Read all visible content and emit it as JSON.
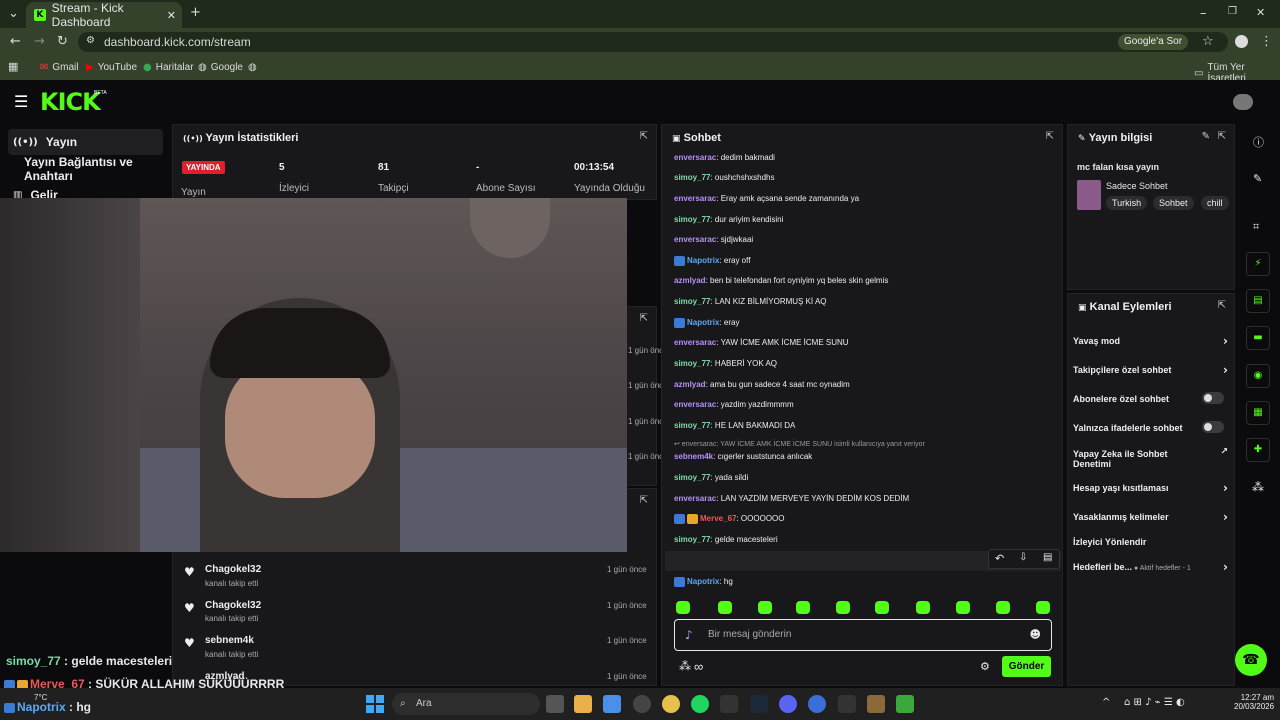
{
  "browser": {
    "tab_title": "Stream - Kick Dashboard",
    "url": "dashboard.kick.com/stream",
    "google_ask": "Google'a Sor",
    "bookmarks": [
      "Gmail",
      "YouTube",
      "Haritalar",
      "Google"
    ],
    "all_bookmarks": "Tüm Yer İşaretleri"
  },
  "kick": {
    "logo": "KICK",
    "beta": "BETA"
  },
  "sidebar": {
    "items": [
      {
        "label": "Yayın",
        "icon": "broadcast-icon"
      },
      {
        "label": "Yayın Bağlantısı ve Anahtarı"
      },
      {
        "label": "Gelir",
        "icon": "chart-icon"
      }
    ]
  },
  "stats": {
    "title": "Yayın İstatistikleri",
    "live_badge": "YAYINDA",
    "live_label": "Yayın",
    "viewers_value": "5",
    "viewers_label": "İzleyici",
    "followers_value": "81",
    "followers_label": "Takipçi",
    "subs_value": "-",
    "subs_label": "Abone Sayısı",
    "uptime_value": "00:13:54",
    "uptime_label": "Yayında Olduğu"
  },
  "activity": {
    "times": [
      "1 gün önce",
      "1 gün önce",
      "1 gün önce",
      "1 gün önce"
    ],
    "follows": [
      {
        "name": "Chagokel32",
        "sub": "kanalı takip etti",
        "time": "1 gün önce"
      },
      {
        "name": "Chagokel32",
        "sub": "kanalı takip etti",
        "time": "1 gün önce"
      },
      {
        "name": "sebnem4k",
        "sub": "kanalı takip etti",
        "time": "1 gün önce"
      },
      {
        "name": "azmlyad",
        "sub": "",
        "time": "1 gün önce"
      }
    ]
  },
  "chat": {
    "title": "Sohbet",
    "messages": [
      {
        "user": "enversarac",
        "text": ": dedim bakmadi",
        "color": "purple"
      },
      {
        "user": "simoy_77",
        "text": ": oushchshxshdhs",
        "color": "green"
      },
      {
        "user": "enversarac",
        "text": ": Eray amk açsana sende zamanında ya",
        "color": "purple"
      },
      {
        "user": "simoy_77",
        "text": ": dur ariyim kendisini",
        "color": "green"
      },
      {
        "user": "enversarac",
        "text": ": sjdjwkaai",
        "color": "purple"
      },
      {
        "user": "Napotrix",
        "text": ": eray off",
        "color": "blue",
        "badge": true
      },
      {
        "user": "azmlyad",
        "text": ": ben bi telefondan fort oyniyim yq beles skin gelmis",
        "color": "purple"
      },
      {
        "user": "simoy_77",
        "text": ": LAN KIZ BİLMİYORMUŞ Kİ AQ",
        "color": "green"
      },
      {
        "user": "Napotrix",
        "text": ": eray",
        "color": "blue",
        "badge": true
      },
      {
        "user": "enversarac",
        "text": ": YAW İCME AMK İCME İCME SUNU",
        "color": "purple"
      },
      {
        "user": "simoy_77",
        "text": ": HABERİ YOK AQ",
        "color": "green"
      },
      {
        "user": "azmlyad",
        "text": ": ama bu gun sadece 4 saat mc oynadim",
        "color": "purple"
      },
      {
        "user": "enversarac",
        "text": ": yazdim yazdimmmm",
        "color": "purple"
      },
      {
        "user": "simoy_77",
        "text": ": HE LAN BAKMADI DA",
        "color": "green"
      },
      {
        "user": "sebnem4k",
        "text": ": cıgerler suststunca anlıcak",
        "color": "purple"
      },
      {
        "user": "simoy_77",
        "text": ": yada sildi",
        "color": "green"
      },
      {
        "user": "enversarac",
        "text": ": LAN YAZDİM MERVEYE YAYİN DEDİM KOS DEDİM",
        "color": "purple"
      },
      {
        "user": "Merve_67",
        "text": ": OOOOOOO",
        "color": "red",
        "badge": true,
        "crown": true
      },
      {
        "user": "simoy_77",
        "text": ": gelde macesteleri",
        "color": "green"
      },
      {
        "user": "Merve_67",
        "text": ": ŞÜKÜR ALLAHIM ŞÜKÜÜÜRRRR",
        "color": "red",
        "badge": true,
        "crown": true
      },
      {
        "user": "Napotrix",
        "text": ": hg",
        "color": "blue",
        "badge": true
      }
    ],
    "reply_note": "↩ enversarac: YAW İCME AMK İCME İCME SUNU isimli kullanıcıya yanıt veriyor",
    "placeholder": "Bir mesaj gönderin",
    "send": "Gönder",
    "infinity": "∞"
  },
  "stream_info": {
    "title": "Yayın bilgisi",
    "stream_title": "mc falan kısa yayın",
    "category": "Sadece Sohbet",
    "tags": [
      "Turkish",
      "Sohbet",
      "chill"
    ]
  },
  "channel_actions": {
    "title": "Kanal Eylemleri",
    "items": [
      {
        "label": "Yavaş mod",
        "type": "chevron"
      },
      {
        "label": "Takipçilere özel sohbet",
        "type": "chevron"
      },
      {
        "label": "Abonelere özel sohbet",
        "type": "toggle"
      },
      {
        "label": "Yalnızca ifadelerle sohbet",
        "type": "toggle"
      },
      {
        "label": "Yapay Zeka ile Sohbet Denetimi",
        "type": "external"
      },
      {
        "label": "Hesap yaşı kısıtlaması",
        "type": "chevron"
      },
      {
        "label": "Yasaklanmış kelimeler",
        "type": "chevron"
      },
      {
        "label": "İzleyici Yönlendir",
        "type": "none"
      },
      {
        "label": "Hedefleri be...",
        "type": "chevron",
        "extra": "Aktif hedefler - 1"
      }
    ]
  },
  "overlay": {
    "line1_user": "simoy_77",
    "line1_text": " : gelde macesteleri",
    "line2_user": "Merve_67",
    "line2_text": " : ŞÜKÜR ALLAHIM ŞÜKÜÜÜRRRR",
    "line3_user": "Napotrix",
    "line3_text": " : hg"
  },
  "taskbar": {
    "weather": "7°C",
    "search": "Ara",
    "time": "12:27 am",
    "date": "20/03/2026"
  }
}
